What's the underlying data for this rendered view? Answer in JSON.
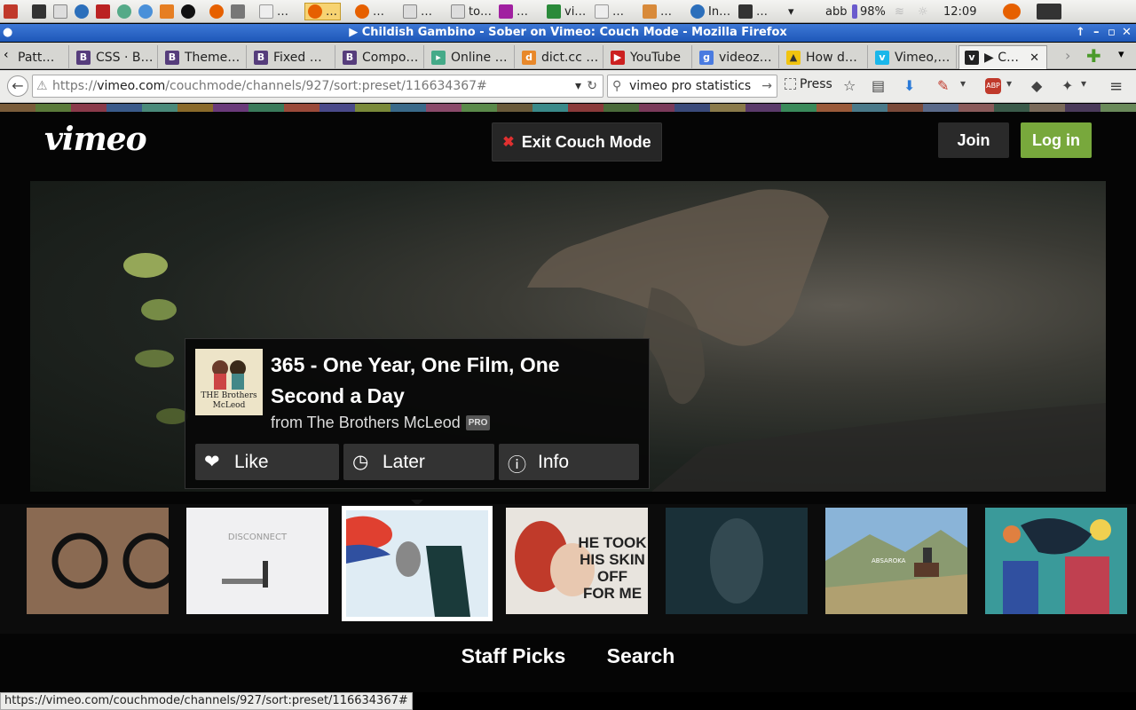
{
  "taskbar": {
    "items": [
      "…",
      "…",
      "…",
      "to…",
      "…",
      "vi…",
      "…",
      "…",
      "In…",
      "…"
    ],
    "active_item": "…",
    "user": "abb",
    "battery": "98%",
    "clock": "12:09"
  },
  "window": {
    "title": "▶ Childish Gambino - Sober on Vimeo: Couch Mode - Mozilla Firefox"
  },
  "tabs": [
    {
      "label": "Patt…",
      "icon": "puzzle-icon",
      "color": "#6a8"
    },
    {
      "label": "CSS · B…",
      "icon": "bootstrap-icon",
      "color": "#563d7c"
    },
    {
      "label": "Theme…",
      "icon": "bootstrap-icon",
      "color": "#563d7c"
    },
    {
      "label": "Fixed …",
      "icon": "bootstrap-icon",
      "color": "#563d7c"
    },
    {
      "label": "Compo…",
      "icon": "bootstrap-icon",
      "color": "#563d7c"
    },
    {
      "label": "Online …",
      "icon": "google-icon",
      "color": "#4a8"
    },
    {
      "label": "dict.cc …",
      "icon": "dict-icon",
      "color": "#e8882a"
    },
    {
      "label": "YouTube",
      "icon": "youtube-icon",
      "color": "#cc2020"
    },
    {
      "label": "videoz…",
      "icon": "google-icon",
      "color": "#4a7be0"
    },
    {
      "label": "How d…",
      "icon": "stack-icon",
      "color": "#f1c40f"
    },
    {
      "label": "Vimeo,…",
      "icon": "vimeo-icon",
      "color": "#1ab7ea"
    },
    {
      "label": "▶ C…",
      "icon": "vimeo-icon",
      "color": "#222"
    }
  ],
  "navbar": {
    "url_prefix": "https://",
    "url_domain": "vimeo.com",
    "url_path": "/couchmode/channels/927/sort:preset/116634367#",
    "search_value": "vimeo pro statistics",
    "press_label": "Press"
  },
  "stripe_colors": [
    "#7a5c3a",
    "#5a7a3a",
    "#8a3a4a",
    "#3a5a8a",
    "#4a8a7a",
    "#8a6a2a",
    "#6a3a7a",
    "#3a7a5a",
    "#9a4a3a",
    "#4a4a8a",
    "#7a8a3a",
    "#3a6a8a",
    "#8a4a6a",
    "#5a8a4a",
    "#6a5a3a",
    "#3a8a8a",
    "#8a3a3a",
    "#4a6a3a",
    "#7a3a5a",
    "#3a4a7a",
    "#8a7a4a",
    "#5a3a6a",
    "#3a8a5a",
    "#9a5a3a",
    "#4a7a8a",
    "#7a4a3a",
    "#5a6a8a",
    "#8a5a5a",
    "#3a5a4a",
    "#7a6a5a",
    "#4a3a5a",
    "#6a8a5a"
  ],
  "vimeo": {
    "logo": "vimeo",
    "exit_label": "Exit Couch Mode",
    "join_label": "Join",
    "login_label": "Log in"
  },
  "video": {
    "title": "365 - One Year, One Film, One Second a Day",
    "from": "from The Brothers McLeod",
    "badge": "PRO",
    "thumb_text": "THE Brothers McLeod",
    "actions": {
      "like": "Like",
      "later": "Later",
      "info": "Info"
    }
  },
  "thumbnails": [
    {
      "name": "thumb-glasses",
      "text": ""
    },
    {
      "name": "thumb-disconnect",
      "text": "DISCONNECT"
    },
    {
      "name": "thumb-cartoon",
      "text": ""
    },
    {
      "name": "thumb-skin",
      "text": "HE TOOK HIS SKIN OFF FOR ME"
    },
    {
      "name": "thumb-dark",
      "text": ""
    },
    {
      "name": "thumb-cowboy",
      "text": "ABSAROKA"
    },
    {
      "name": "thumb-pattern",
      "text": ""
    }
  ],
  "bottom_nav": {
    "staff_picks": "Staff Picks",
    "search": "Search"
  },
  "status_url": "https://vimeo.com/couchmode/channels/927/sort:preset/116634367#"
}
